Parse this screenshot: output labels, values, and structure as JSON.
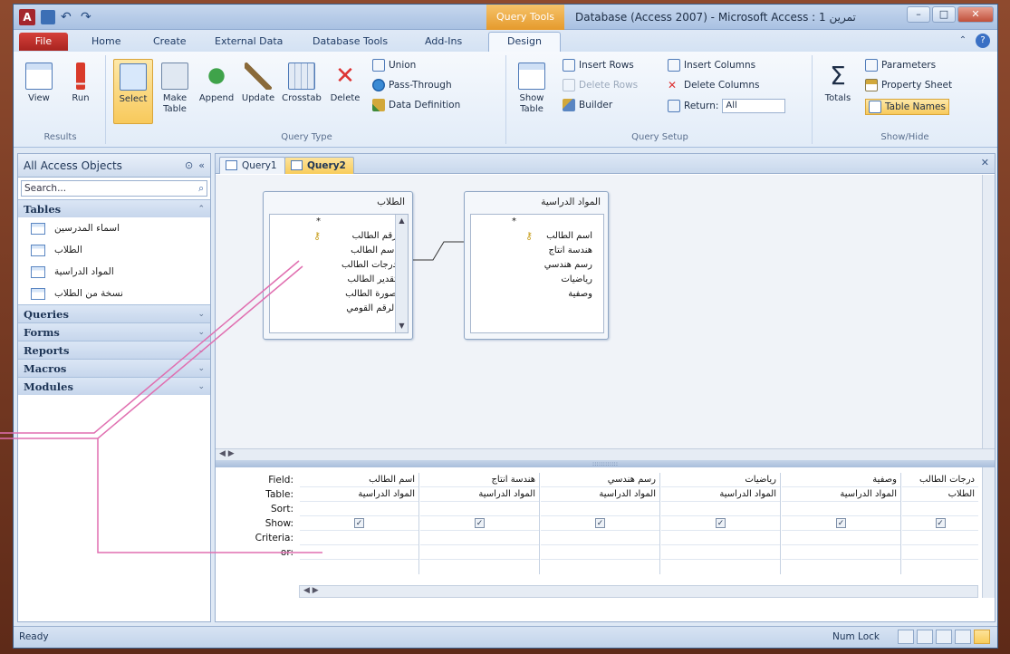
{
  "title_bar": {
    "contextual_tab": "Query Tools",
    "window_title": "Database (Access 2007) - Microsoft Access : تمرين 1",
    "controls": [
      "–",
      "□",
      "✕"
    ]
  },
  "tabs": [
    "File",
    "Home",
    "Create",
    "External Data",
    "Database Tools",
    "Add-Ins",
    "Design"
  ],
  "ribbon": {
    "results": {
      "label": "Results",
      "view": "View",
      "run": "Run"
    },
    "query_type": {
      "label": "Query Type",
      "select": "Select",
      "make_table": "Make Table",
      "append": "Append",
      "update": "Update",
      "crosstab": "Crosstab",
      "delete": "Delete",
      "union": "Union",
      "pass_through": "Pass-Through",
      "data_definition": "Data Definition"
    },
    "query_setup": {
      "label": "Query Setup",
      "show_table": "Show Table",
      "insert_rows": "Insert Rows",
      "delete_rows": "Delete Rows",
      "builder": "Builder",
      "insert_columns": "Insert Columns",
      "delete_columns": "Delete Columns",
      "return": "Return:",
      "return_value": "All"
    },
    "show_hide": {
      "label": "Show/Hide",
      "totals": "Totals",
      "parameters": "Parameters",
      "property_sheet": "Property Sheet",
      "table_names": "Table Names"
    }
  },
  "nav": {
    "header": "All Access Objects",
    "search_placeholder": "Search...",
    "sections": {
      "tables": "Tables",
      "queries": "Queries",
      "forms": "Forms",
      "reports": "Reports",
      "macros": "Macros",
      "modules": "Modules"
    },
    "tables": [
      "اسماء المدرسين",
      "الطلاب",
      "المواد الدراسية",
      "نسخة من الطلاب"
    ]
  },
  "doc_tabs": [
    "Query1",
    "Query2"
  ],
  "design": {
    "table1": {
      "title": "الطلاب",
      "fields": [
        "*",
        "رقم الطالب",
        "اسم الطالب",
        "درجات الطالب",
        "تقدير الطالب",
        "صورة الطالب",
        "الرقم القومي"
      ]
    },
    "table2": {
      "title": "المواد الدراسية",
      "fields": [
        "*",
        "اسم الطالب",
        "هندسة انتاج",
        "رسم هندسي",
        "رياضيات",
        "وصفية"
      ]
    }
  },
  "grid": {
    "row_labels": [
      "Field:",
      "Table:",
      "Sort:",
      "Show:",
      "Criteria:",
      "or:"
    ],
    "columns": [
      {
        "field": "اسم الطالب",
        "table": "المواد الدراسية",
        "show": "✓"
      },
      {
        "field": "هندسة انتاج",
        "table": "المواد الدراسية",
        "show": "✓"
      },
      {
        "field": "رسم هندسي",
        "table": "المواد الدراسية",
        "show": "✓"
      },
      {
        "field": "رياضيات",
        "table": "المواد الدراسية",
        "show": "✓"
      },
      {
        "field": "وصفية",
        "table": "المواد الدراسية",
        "show": "✓"
      },
      {
        "field": "درجات الطالب",
        "table": "الطلاب",
        "show": "✓"
      }
    ]
  },
  "status": {
    "left": "Ready",
    "numlock": "Num Lock"
  },
  "colors": {
    "accent": "#f8c95b",
    "file_tab": "#a82420",
    "annotation": "#e06fb0"
  }
}
